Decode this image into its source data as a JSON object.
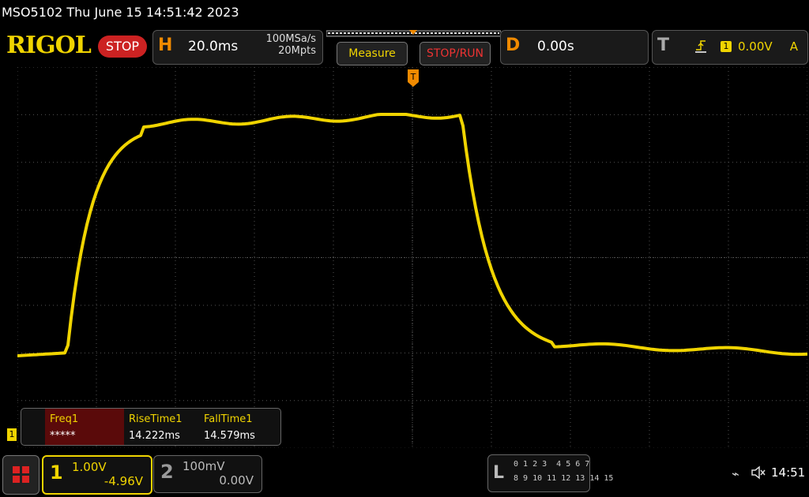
{
  "title": "MSO5102  Thu June 15 14:51:42 2023",
  "logo": "RIGOL",
  "run_state": "STOP",
  "horizontal": {
    "key": "H",
    "timebase": "20.0ms",
    "sample_rate": "100MSa/s",
    "depth": "20Mpts"
  },
  "buttons": {
    "measure": "Measure",
    "stop_run": "STOP/RUN"
  },
  "delay": {
    "key": "D",
    "value": "0.00s"
  },
  "trigger": {
    "key": "T",
    "source": "1",
    "level": "0.00V",
    "mode": "A"
  },
  "measurements": [
    {
      "name": "Freq1",
      "value": "*****"
    },
    {
      "name": "RiseTime1",
      "value": "14.222ms"
    },
    {
      "name": "FallTime1",
      "value": "14.579ms"
    }
  ],
  "channel1": {
    "num": "1",
    "scale": "1.00V",
    "offset": "-4.96V",
    "marker": "1"
  },
  "channel2": {
    "num": "2",
    "scale": "100mV",
    "offset": "0.00V"
  },
  "logic": {
    "key": "L",
    "row1": "0 1 2 3  4 5 6 7",
    "row2": "8 9 10 11 12 13 14 15"
  },
  "clock": "14:51",
  "colors": {
    "ch1": "#f0d400",
    "accent": "#f08a00",
    "stop": "#cc2222"
  },
  "icons": [
    "menu-icon",
    "usb-icon",
    "speaker-muted-icon",
    "trigger-edge-icon",
    "trigger-position-icon"
  ]
}
